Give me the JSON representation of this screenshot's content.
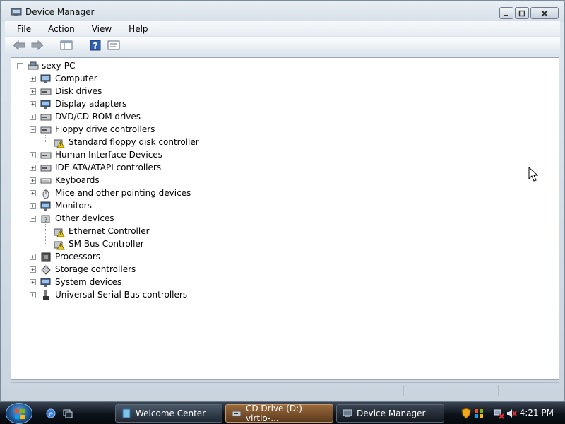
{
  "window": {
    "title": "Device Manager",
    "title_icon": "device-manager-icon",
    "buttons": {
      "minimize": "minimize-icon",
      "maximize": "maximize-icon",
      "close": "close-icon"
    }
  },
  "menu": [
    "File",
    "Action",
    "View",
    "Help"
  ],
  "toolbar": [
    "back-arrow-icon",
    "forward-arrow-icon",
    "show-hide-tree-icon",
    "help-icon",
    "properties-icon"
  ],
  "tree": {
    "root": "sexy-PC",
    "categories": [
      {
        "label": "Computer",
        "icon": "computer-icon",
        "expanded": false
      },
      {
        "label": "Disk drives",
        "icon": "disk-drive-icon",
        "expanded": false
      },
      {
        "label": "Display adapters",
        "icon": "display-adapter-icon",
        "expanded": false
      },
      {
        "label": "DVD/CD-ROM drives",
        "icon": "cdrom-icon",
        "expanded": false
      },
      {
        "label": "Floppy drive controllers",
        "icon": "floppy-controller-icon",
        "expanded": true,
        "children": [
          {
            "label": "Standard floppy disk controller",
            "icon": "warning-device-icon"
          }
        ]
      },
      {
        "label": "Human Interface Devices",
        "icon": "hid-icon",
        "expanded": false
      },
      {
        "label": "IDE ATA/ATAPI controllers",
        "icon": "ide-controller-icon",
        "expanded": false
      },
      {
        "label": "Keyboards",
        "icon": "keyboard-icon",
        "expanded": false
      },
      {
        "label": "Mice and other pointing devices",
        "icon": "mouse-icon",
        "expanded": false
      },
      {
        "label": "Monitors",
        "icon": "monitor-icon",
        "expanded": false
      },
      {
        "label": "Other devices",
        "icon": "unknown-device-icon",
        "expanded": true,
        "children": [
          {
            "label": "Ethernet Controller",
            "icon": "warning-device-icon"
          },
          {
            "label": "SM Bus Controller",
            "icon": "warning-device-icon"
          }
        ]
      },
      {
        "label": "Processors",
        "icon": "processor-icon",
        "expanded": false
      },
      {
        "label": "Storage controllers",
        "icon": "storage-controller-icon",
        "expanded": false
      },
      {
        "label": "System devices",
        "icon": "system-device-icon",
        "expanded": false
      },
      {
        "label": "Universal Serial Bus controllers",
        "icon": "usb-icon",
        "expanded": false
      }
    ]
  },
  "taskbar": {
    "quick_launch": [
      "show-desktop-icon",
      "switch-windows-icon"
    ],
    "tasks": [
      {
        "label": "Welcome Center",
        "icon": "welcome-center-icon",
        "state": "normal"
      },
      {
        "label": "CD Drive (D:) virtio-...",
        "icon": "cd-drive-icon",
        "state": "flashing"
      },
      {
        "label": "Device Manager",
        "icon": "device-manager-icon",
        "state": "current"
      }
    ],
    "tray_icons": [
      "security-shield-icon",
      "windows-security-icon",
      "network-disconnected-icon",
      "volume-muted-icon"
    ],
    "clock": "4:21 PM"
  },
  "colors": {
    "tree_bg": "#ffffff",
    "taskbar": "#0c131b",
    "task_flash": "#9a6a3c",
    "window_chrome": "#d6dfe8"
  }
}
